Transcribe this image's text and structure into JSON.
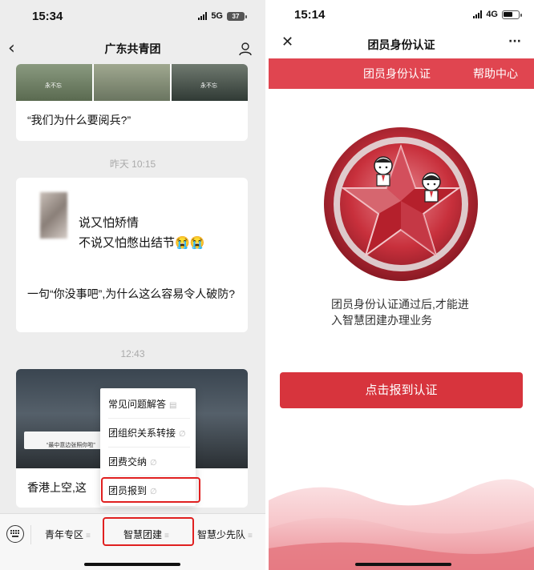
{
  "left": {
    "status": {
      "time": "15:34",
      "network": "5G",
      "battery": "37"
    },
    "nav": {
      "title": "广东共青团"
    },
    "article1": {
      "thumb_labels": [
        "永不忘",
        "永不忘"
      ],
      "title": "“我们为什么要阅兵?”"
    },
    "timestamp1": "昨天 10:15",
    "article2": {
      "line1": "说又怕矫情",
      "line2": "不说又怕憋出结节😭😭",
      "title": "一句“你没事吧”,为什么这么容易令人破防?"
    },
    "timestamp2": "12:43",
    "article3": {
      "caption": "“最中意边张照你啦”",
      "title_partial": "香港上空,这"
    },
    "popup_menu": {
      "items": [
        {
          "label": "常见问题解答"
        },
        {
          "label": "团组织关系转接"
        },
        {
          "label": "团费交纳"
        },
        {
          "label": "团员报到"
        }
      ]
    },
    "bottom_menu": {
      "items": [
        {
          "label": "青年专区"
        },
        {
          "label": "智慧团建"
        },
        {
          "label": "智慧少先队"
        }
      ]
    }
  },
  "right": {
    "status": {
      "time": "15:14",
      "network": "4G"
    },
    "nav": {
      "title": "团员身份认证",
      "more": "···"
    },
    "banner": {
      "link1": "团员身份认证",
      "link2": "帮助中心"
    },
    "description": "团员身份认证通过后,才能进入智慧团建办理业务",
    "button_label": "点击报到认证"
  },
  "colors": {
    "highlight": "#e02020",
    "banner": "#e04550",
    "primary_button": "#d7343d",
    "chat_bg": "#ededed"
  }
}
